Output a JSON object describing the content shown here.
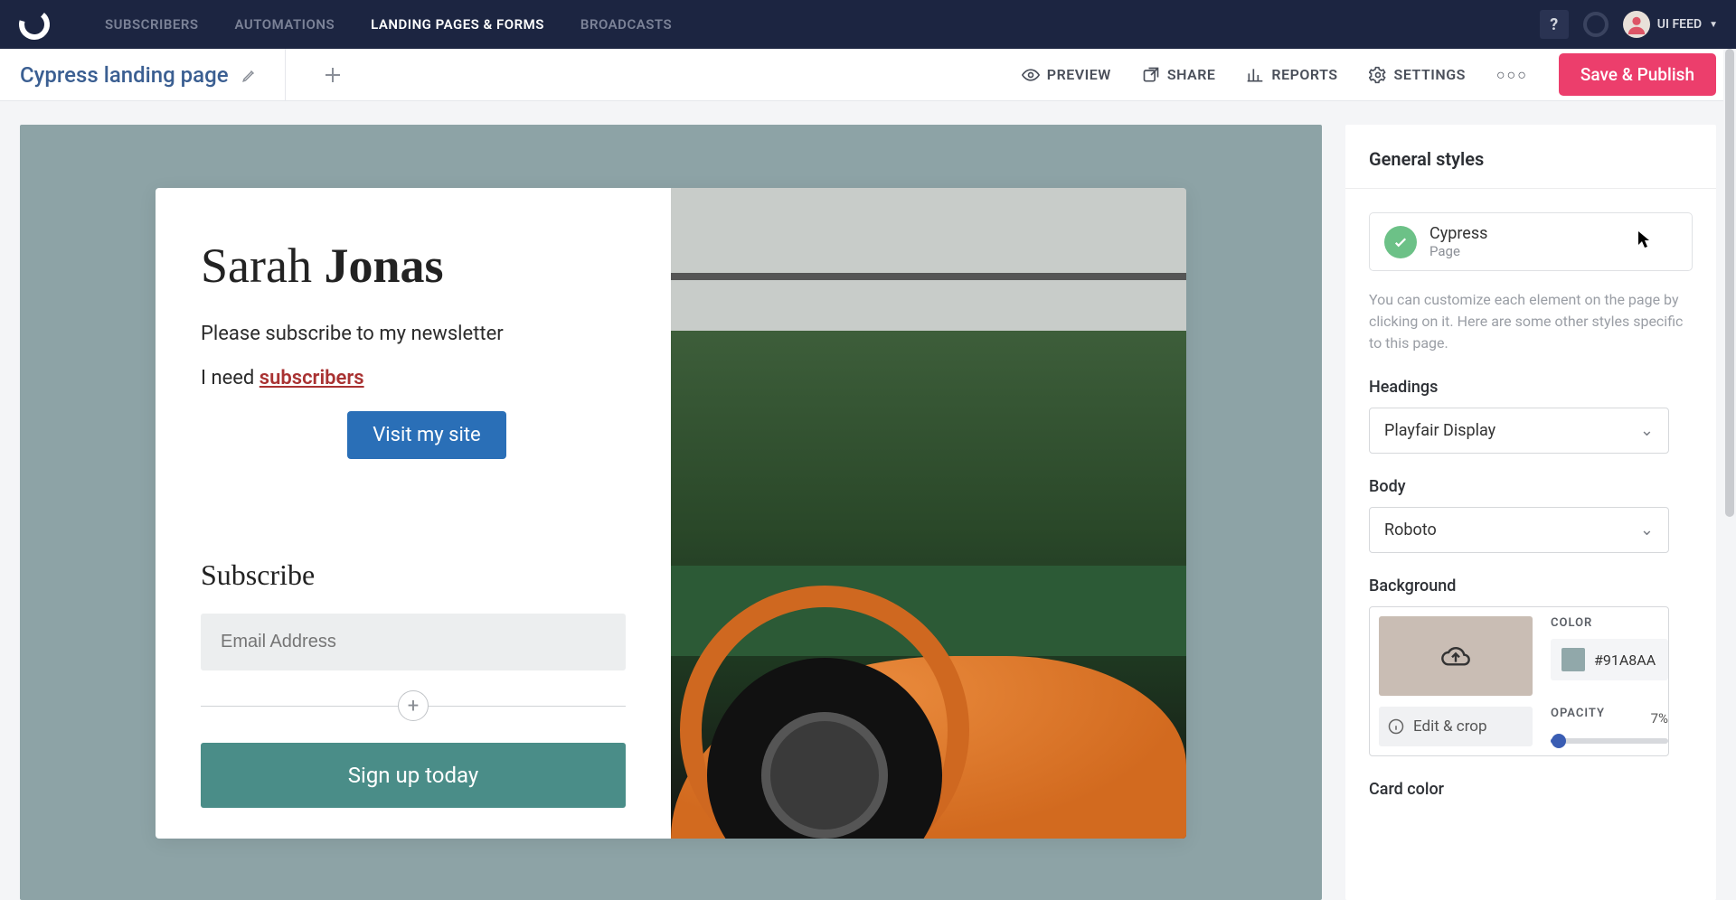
{
  "topnav": {
    "links": [
      "SUBSCRIBERS",
      "AUTOMATIONS",
      "LANDING PAGES & FORMS",
      "BROADCASTS"
    ],
    "help": "?",
    "account": "UI FEED"
  },
  "subtool": {
    "page_title": "Cypress landing page",
    "preview": "PREVIEW",
    "share": "SHARE",
    "reports": "REPORTS",
    "settings": "SETTINGS",
    "save_publish": "Save & Publish"
  },
  "card": {
    "heading_first": "Sarah ",
    "heading_bold": "Jonas",
    "subtext": "Please subscribe to my newsletter",
    "need_prefix": "I need ",
    "need_link": "subscribers",
    "visit_btn": "Visit my site",
    "subscribe_head": "Subscribe",
    "email_placeholder": "Email Address",
    "signup_btn": "Sign up today"
  },
  "panel": {
    "title": "General styles",
    "selected_name": "Cypress",
    "selected_sub": "Page",
    "desc": "You can customize each element on the page by clicking on it. Here are some other styles specific to this page.",
    "headings_label": "Headings",
    "headings_value": "Playfair Display",
    "body_label": "Body",
    "body_value": "Roboto",
    "background_label": "Background",
    "color_label": "COLOR",
    "color_hex": "#91A8AA",
    "edit_crop": "Edit & crop",
    "opacity_label": "OPACITY",
    "opacity_value": "7%",
    "card_color_label": "Card color"
  }
}
